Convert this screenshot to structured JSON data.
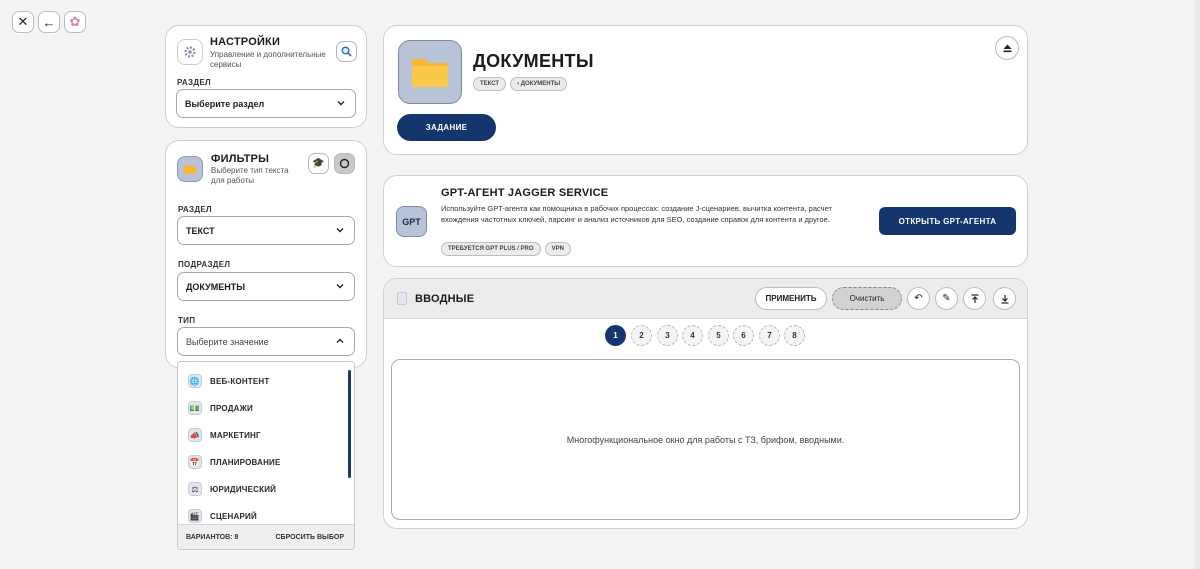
{
  "topbar": {
    "close_icon": "close-icon",
    "back_icon": "arrow-left-icon",
    "brain_icon": "brain-icon"
  },
  "settings": {
    "title": "НАСТРОЙКИ",
    "subtitle": "Управление и дополнительные сервисы",
    "section_label": "РАЗДЕЛ",
    "section_placeholder": "Выберите раздел"
  },
  "filters": {
    "title": "ФИЛЬТРЫ",
    "subtitle": "Выберите тип текста для работы",
    "section_label": "РАЗДЕЛ",
    "section_value": "ТЕКСТ",
    "subsection_label": "ПОДРАЗДЕЛ",
    "subsection_value": "ДОКУМЕНТЫ",
    "type_label": "ТИП",
    "type_placeholder": "Выберите значение"
  },
  "dropdown": {
    "items": [
      {
        "label": "ВЕБ-КОНТЕНТ",
        "icon": "🌐"
      },
      {
        "label": "ПРОДАЖИ",
        "icon": "💵"
      },
      {
        "label": "МАРКЕТИНГ",
        "icon": "📣"
      },
      {
        "label": "ПЛАНИРОВАНИЕ",
        "icon": "📅"
      },
      {
        "label": "ЮРИДИЧЕСКИЙ",
        "icon": "⚖"
      },
      {
        "label": "СЦЕНАРИЙ",
        "icon": "🎬"
      }
    ],
    "count_label": "ВАРИАНТОВ: 8",
    "reset_label": "СБРОСИТЬ ВЫБОР"
  },
  "header": {
    "title": "ДОКУМЕНТЫ",
    "breadcrumb": [
      "ТЕКСТ",
      "› ДОКУМЕНТЫ"
    ],
    "task_button": "ЗАДАНИЕ"
  },
  "gpt": {
    "badge": "GPT",
    "title": "GPT-АГЕНТ JAGGER SERVICE",
    "description": "Используйте GPT-агента как помощника в рабочих процессах: создание J-сценариев, вычитка контента, расчет вхождения частотных ключей, парсинг и анализ источников для SEO, создание справок для контента и другое.",
    "tags": [
      "ТРЕБУЕТСЯ GPT PLUS / PRO",
      "VPN"
    ],
    "open_button": "ОТКРЫТЬ GPT-АГЕНТА"
  },
  "input": {
    "title": "ВВОДНЫЕ",
    "apply_button": "ПРИМЕНИТЬ",
    "clear_button": "Очистить",
    "pages": [
      "1",
      "2",
      "3",
      "4",
      "5",
      "6",
      "7",
      "8"
    ],
    "active_page": "1",
    "placeholder": "Многофункциональное окно для работы с ТЗ, брифом, вводными."
  },
  "colors": {
    "navy": "#14356e",
    "folder": "#f7b733",
    "panel_icon_bg": "#b9c3d8"
  }
}
